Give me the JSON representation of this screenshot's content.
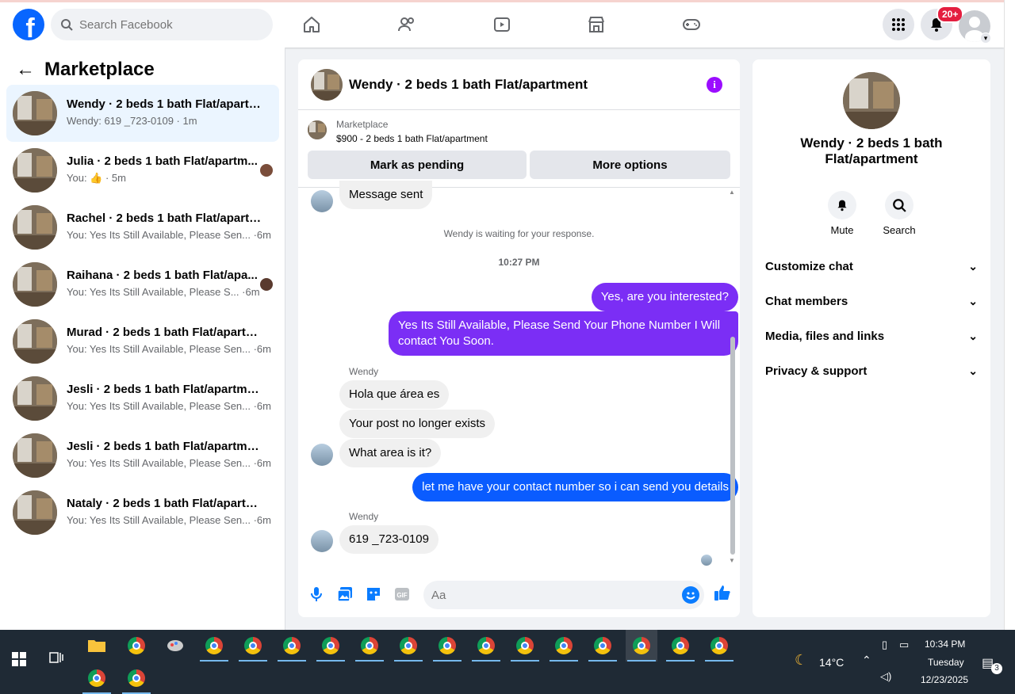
{
  "top": {
    "logo": "f",
    "search_placeholder": "Search Facebook",
    "notif_badge": "20+"
  },
  "sidebar": {
    "back": "←",
    "title": "Marketplace",
    "conversations": [
      {
        "title": "Wendy · 2 beds 1 bath Flat/apartm...",
        "preview": "Wendy: 619 _723-0109 · 1m",
        "active": true
      },
      {
        "title": "Julia · 2 beds 1 bath Flat/apartm...",
        "preview": "You: 👍 · 5m"
      },
      {
        "title": "Rachel · 2 beds 1 bath Flat/apartm...",
        "preview": "You: Yes Its Still Available, Please Sen... ·6m"
      },
      {
        "title": "Raihana · 2 beds 1 bath Flat/apa...",
        "preview": "You: Yes Its Still Available, Please S... ·6m"
      },
      {
        "title": "Murad · 2 beds 1 bath Flat/apartm...",
        "preview": "You: Yes Its Still Available, Please Sen... ·6m"
      },
      {
        "title": "Jesli · 2 beds 1 bath Flat/apartment",
        "preview": "You: Yes Its Still Available, Please Sen... ·6m"
      },
      {
        "title": "Jesli · 2 beds 1 bath Flat/apartment",
        "preview": "You: Yes Its Still Available, Please Sen... ·6m"
      },
      {
        "title": "Nataly · 2 beds 1 bath Flat/apartm...",
        "preview": "You: Yes Its Still Available, Please Sen... ·6m"
      }
    ]
  },
  "chat": {
    "title": "Wendy · 2 beds 1 bath Flat/apartment",
    "info": "i",
    "listing_source": "Marketplace",
    "listing_price": "$900 - 2 beds 1 bath Flat/apartment",
    "mark_pending": "Mark as pending",
    "more_options": "More options",
    "messages": {
      "m1": "Message sent",
      "waiting": "Wendy is waiting for your response.",
      "time": "10:27 PM",
      "out1": "Yes, are you interested?",
      "out2": "Yes Its Still Available, Please Send Your Phone Number I Will contact You Soon.",
      "sender1": "Wendy",
      "in1": "Hola que área es",
      "in2": "Your post no longer exists",
      "in3": "What area is it?",
      "out3": "let me have your contact number so i can send you details",
      "sender2": "Wendy",
      "in4": "619 _723-0109"
    },
    "composer_placeholder": "Aa",
    "gif_label": "GIF"
  },
  "rpanel": {
    "title": "Wendy · 2 beds 1 bath Flat/apartment",
    "mute": "Mute",
    "search": "Search",
    "rows": [
      "Customize chat",
      "Chat members",
      "Media, files and links",
      "Privacy & support"
    ]
  },
  "taskbar": {
    "temp": "14°C",
    "time": "10:34 PM",
    "day": "Tuesday",
    "date": "12/23/2025",
    "notif_count": "3"
  }
}
